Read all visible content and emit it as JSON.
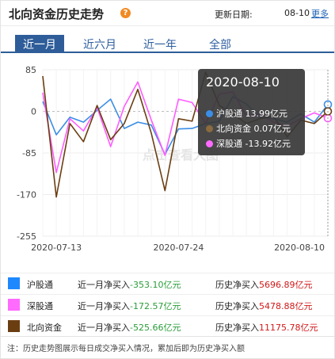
{
  "header": {
    "title": "北向资金历史走势",
    "help_icon": "?",
    "update_label": "更新日期:",
    "update_value": "08-10",
    "more_label": "更多"
  },
  "tabs": [
    {
      "label": "近一月",
      "active": true
    },
    {
      "label": "近六月",
      "active": false
    },
    {
      "label": "近一年",
      "active": false
    },
    {
      "label": "全部",
      "active": false
    }
  ],
  "chart_data": {
    "type": "line",
    "watermark": "点击查看大图",
    "y_ticks": [
      "85",
      "0",
      "-85",
      "-170",
      "-255"
    ],
    "ylim": [
      -255,
      85
    ],
    "x_tick_labels": [
      "2020-07-13",
      "2020-07-24",
      "2020-08-10"
    ],
    "x": [
      "2020-07-10",
      "2020-07-13",
      "2020-07-14",
      "2020-07-15",
      "2020-07-16",
      "2020-07-17",
      "2020-07-20",
      "2020-07-21",
      "2020-07-22",
      "2020-07-23",
      "2020-07-24",
      "2020-07-27",
      "2020-07-28",
      "2020-07-29",
      "2020-07-30",
      "2020-07-31",
      "2020-08-03",
      "2020-08-04",
      "2020-08-05",
      "2020-08-06",
      "2020-08-07",
      "2020-08-10"
    ],
    "series": [
      {
        "name": "沪股通",
        "color": "#3a8ee6",
        "values": [
          20,
          -48,
          -12,
          -22,
          2,
          25,
          -35,
          -22,
          -28,
          -88,
          -36,
          -35,
          -25,
          -20,
          30,
          15,
          -12,
          -15,
          -22,
          -5,
          -22,
          14
        ]
      },
      {
        "name": "深股通",
        "color": "#ff5cff",
        "values": [
          38,
          -125,
          -15,
          -40,
          8,
          -72,
          10,
          60,
          -18,
          -90,
          25,
          18,
          -25,
          35,
          40,
          -10,
          -5,
          -22,
          -30,
          -15,
          -3,
          -14
        ]
      },
      {
        "name": "北向资金",
        "color": "#6b3e12",
        "values": [
          72,
          -175,
          -25,
          -62,
          12,
          -58,
          -25,
          45,
          -45,
          -162,
          -15,
          -20,
          80,
          12,
          -5,
          -25,
          -15,
          -10,
          -52,
          -18,
          -25,
          0
        ]
      }
    ],
    "tooltip": {
      "date": "2020-08-10",
      "rows": [
        {
          "name": "沪股通",
          "value": "13.99亿元"
        },
        {
          "name": "北向资金",
          "value": "0.07亿元"
        },
        {
          "name": "深股通",
          "value": "-13.92亿元"
        }
      ]
    }
  },
  "legend": [
    {
      "name": "沪股通",
      "color": "#1e88ff",
      "recent_label": "近一月净买入",
      "recent_value": "-353.10亿元",
      "hist_label": "历史净买入",
      "hist_value": "5696.89亿元"
    },
    {
      "name": "深股通",
      "color": "#ff6aff",
      "recent_label": "近一月净买入",
      "recent_value": "-172.57亿元",
      "hist_label": "历史净买入",
      "hist_value": "5478.88亿元"
    },
    {
      "name": "北向资金",
      "color": "#6b3e12",
      "recent_label": "近一月净买入",
      "recent_value": "-525.66亿元",
      "hist_label": "历史净买入",
      "hist_value": "11175.78亿元"
    }
  ],
  "note": "注：历史走势图展示每日成交净买入情况，累加后即为历史净买入额"
}
